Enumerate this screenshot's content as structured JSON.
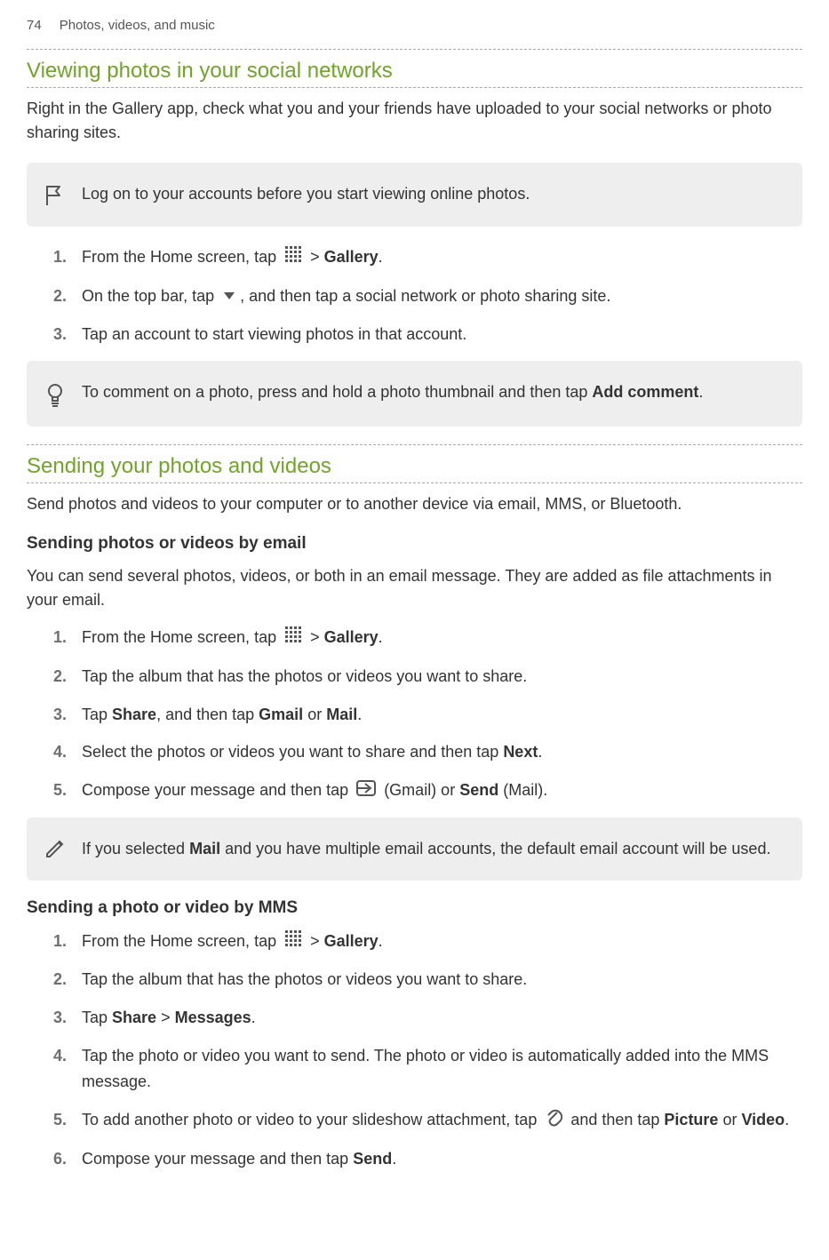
{
  "header": {
    "page_number": "74",
    "breadcrumb": "Photos, videos, and music"
  },
  "section1": {
    "title": "Viewing photos in your social networks",
    "intro": "Right in the Gallery app, check what you and your friends have uploaded to your social networks or photo sharing sites.",
    "callout1": "Log on to your accounts before you start viewing online photos.",
    "steps": {
      "s1_prefix": "From the Home screen, tap ",
      "s1_suffix": " > ",
      "s1_gallery": "Gallery",
      "s1_end": ".",
      "s2_prefix": "On the top bar, tap ",
      "s2_suffix": ", and then tap a social network or photo sharing site.",
      "s3": "Tap an account to start viewing photos in that account."
    },
    "callout2_prefix": "To comment on a photo, press and hold a photo thumbnail and then tap ",
    "callout2_bold": "Add comment",
    "callout2_suffix": "."
  },
  "section2": {
    "title": "Sending your photos and videos",
    "intro": "Send photos and videos to your computer or to another device via email, MMS, or Bluetooth.",
    "sub1": {
      "title": "Sending photos or videos by email",
      "intro": "You can send several photos, videos, or both in an email message. They are added as file attachments in your email.",
      "s1_prefix": "From the Home screen, tap ",
      "s1_suffix": " > ",
      "s1_gallery": "Gallery",
      "s1_end": ".",
      "s2": "Tap the album that has the photos or videos you want to share.",
      "s3_prefix": "Tap ",
      "s3_share": "Share",
      "s3_mid": ", and then tap ",
      "s3_gmail": "Gmail",
      "s3_or": " or ",
      "s3_mail": "Mail",
      "s3_end": ".",
      "s4_prefix": "Select the photos or videos you want to share and then tap ",
      "s4_next": "Next",
      "s4_end": ".",
      "s5_prefix": "Compose your message and then tap ",
      "s5_mid": " (Gmail) or ",
      "s5_send": "Send",
      "s5_end": " (Mail)."
    },
    "callout3_prefix": "If you selected ",
    "callout3_mail": "Mail",
    "callout3_suffix": " and you have multiple email accounts, the default email account will be used.",
    "sub2": {
      "title": "Sending a photo or video by MMS",
      "s1_prefix": "From the Home screen, tap ",
      "s1_suffix": " > ",
      "s1_gallery": "Gallery",
      "s1_end": ".",
      "s2": "Tap the album that has the photos or videos you want to share.",
      "s3_prefix": "Tap ",
      "s3_share": "Share",
      "s3_mid": " > ",
      "s3_messages": "Messages",
      "s3_end": ".",
      "s4": "Tap the photo or video you want to send. The photo or video is automatically added into the MMS message.",
      "s5_prefix": "To add another photo or video to your slideshow attachment, tap ",
      "s5_mid": " and then tap ",
      "s5_picture": "Picture",
      "s5_or": " or ",
      "s5_video": "Video",
      "s5_end": ".",
      "s6_prefix": "Compose your message and then tap ",
      "s6_send": "Send",
      "s6_end": "."
    }
  },
  "numbers": {
    "n1": "1.",
    "n2": "2.",
    "n3": "3.",
    "n4": "4.",
    "n5": "5.",
    "n6": "6."
  }
}
